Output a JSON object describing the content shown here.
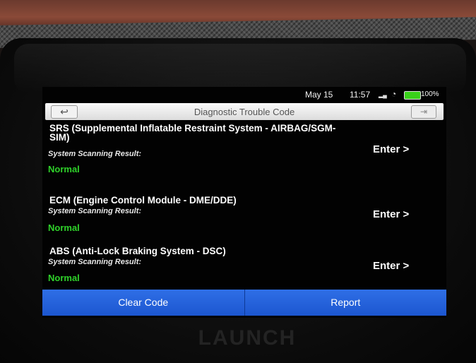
{
  "statusbar": {
    "date": "May 15",
    "time": "11:57",
    "battery": "100%",
    "signal_icon": "signal-icon",
    "wifi_icon": "wifi-icon",
    "battery_icon": "battery-icon",
    "battery_color": "#39d11a"
  },
  "header": {
    "title": "Diagnostic Trouble Code",
    "back_icon": "↩",
    "exit_icon": "⇥"
  },
  "systems": [
    {
      "name": "SRS (Supplemental Inflatable Restraint System - AIRBAG/SGM-SIM)",
      "result_label": "System Scanning Result:",
      "result": "Normal",
      "action": "Enter >"
    },
    {
      "name": "ECM (Engine Control Module - DME/DDE)",
      "result_label": "System Scanning Result:",
      "result": "Normal",
      "action": "Enter >"
    },
    {
      "name": "ABS (Anti-Lock Braking System - DSC)",
      "result_label": "System Scanning Result:",
      "result": "Normal",
      "action": "Enter >"
    }
  ],
  "footer": {
    "clear_label": "Clear Code",
    "report_label": "Report",
    "button_color": "#1c56d0"
  },
  "device": {
    "brand": "LAUNCH"
  },
  "colors": {
    "normal_status": "#2fd12a",
    "screen_bg": "#020202"
  }
}
